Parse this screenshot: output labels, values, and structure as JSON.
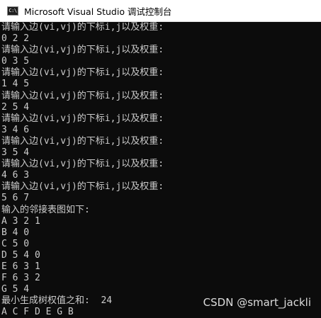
{
  "window": {
    "title": "Microsoft Visual Studio 调试控制台",
    "icon_text": "C:\\",
    "icon_name": "console-app-icon",
    "background_color": "#0c0c0c",
    "text_color": "#cccccc"
  },
  "console": {
    "lines": [
      "请输入边(vi,vj)的下标i,j以及权重:",
      "0 2 2",
      "请输入边(vi,vj)的下标i,j以及权重:",
      "0 3 5",
      "请输入边(vi,vj)的下标i,j以及权重:",
      "1 4 5",
      "请输入边(vi,vj)的下标i,j以及权重:",
      "2 5 4",
      "请输入边(vi,vj)的下标i,j以及权重:",
      "3 4 6",
      "请输入边(vi,vj)的下标i,j以及权重:",
      "3 5 4",
      "请输入边(vi,vj)的下标i,j以及权重:",
      "4 6 3",
      "请输入边(vi,vj)的下标i,j以及权重:",
      "5 6 7",
      "输入的邻接表图如下:",
      "A 3 2 1",
      "B 4 0",
      "C 5 0",
      "D 5 4 0",
      "E 6 3 1",
      "F 6 3 2",
      "G 5 4",
      "最小生成树权值之和:  24",
      "A C F D E G B"
    ]
  },
  "watermark": {
    "text": "CSDN @smart_jackli"
  }
}
